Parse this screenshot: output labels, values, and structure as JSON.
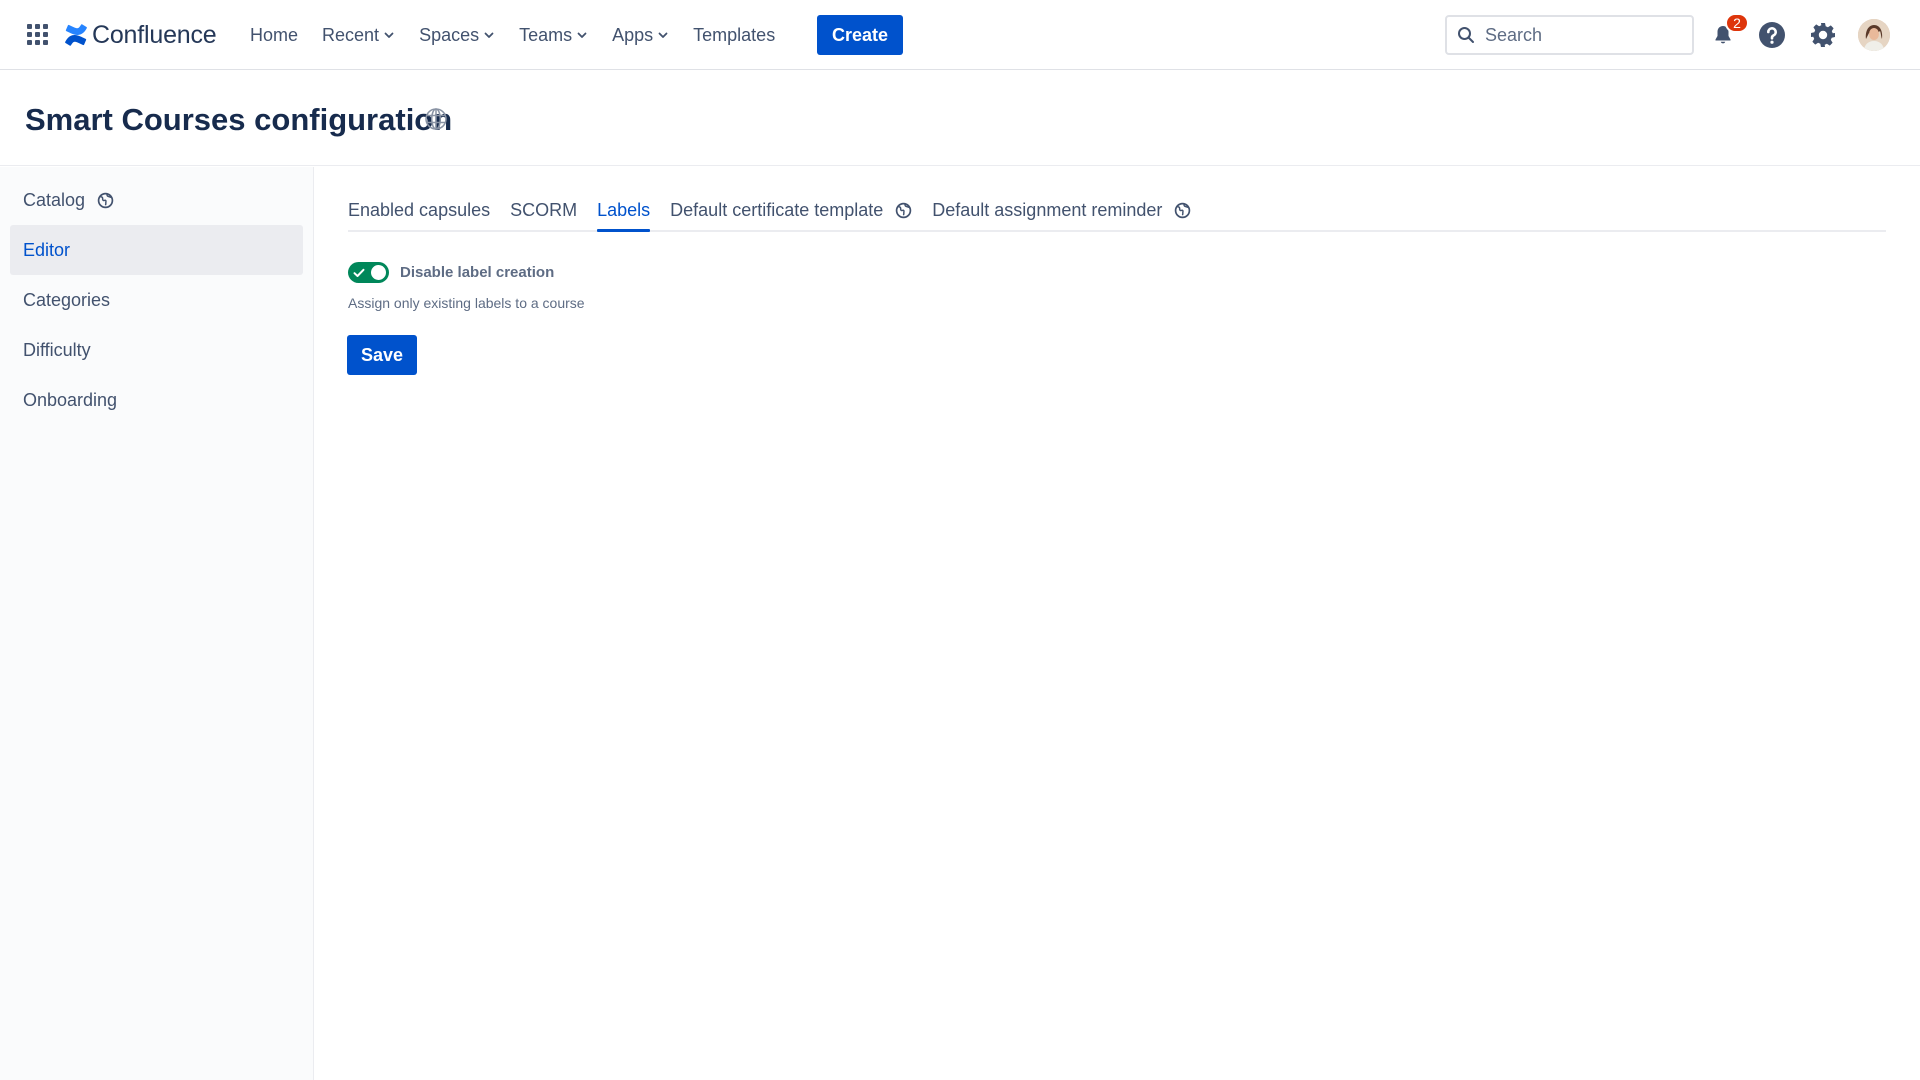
{
  "topnav": {
    "brand": "Confluence",
    "items": [
      {
        "label": "Home",
        "dropdown": false
      },
      {
        "label": "Recent",
        "dropdown": true
      },
      {
        "label": "Spaces",
        "dropdown": true
      },
      {
        "label": "Teams",
        "dropdown": true
      },
      {
        "label": "Apps",
        "dropdown": true
      },
      {
        "label": "Templates",
        "dropdown": false
      }
    ],
    "create_label": "Create",
    "search_placeholder": "Search",
    "notification_count": "2",
    "icons": [
      "app-switcher-icon",
      "confluence-logo-icon",
      "search-icon",
      "notifications-icon",
      "help-icon",
      "settings-icon",
      "avatar"
    ]
  },
  "page": {
    "title": "Smart Courses configuration"
  },
  "sidebar": {
    "items": [
      {
        "label": "Catalog",
        "globe": true,
        "active": false
      },
      {
        "label": "Editor",
        "globe": false,
        "active": true
      },
      {
        "label": "Categories",
        "globe": false,
        "active": false
      },
      {
        "label": "Difficulty",
        "globe": false,
        "active": false
      },
      {
        "label": "Onboarding",
        "globe": false,
        "active": false
      }
    ]
  },
  "main": {
    "tabs": [
      {
        "label": "Enabled capsules",
        "globe": false,
        "active": false
      },
      {
        "label": "SCORM",
        "globe": false,
        "active": false
      },
      {
        "label": "Labels",
        "globe": false,
        "active": true
      },
      {
        "label": "Default certificate template",
        "globe": true,
        "active": false
      },
      {
        "label": "Default assignment reminder",
        "globe": true,
        "active": false
      }
    ],
    "toggle": {
      "label": "Disable label creation",
      "checked": true
    },
    "help_text": "Assign only existing labels to a course",
    "save_label": "Save"
  },
  "colors": {
    "primary": "#0052cc",
    "toggle_on": "#00875a",
    "badge": "#de350b",
    "text": "#172b4d",
    "subtle_text": "#42526e"
  }
}
